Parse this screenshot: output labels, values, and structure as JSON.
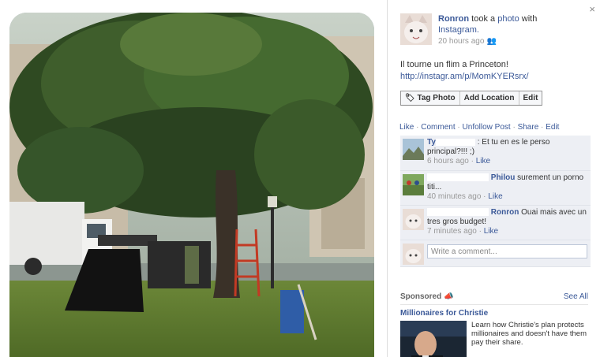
{
  "post": {
    "owner": "Ronron",
    "action_text": "took a",
    "object": "photo",
    "with_text": "with",
    "app": "Instagram.",
    "time": "20 hours ago",
    "message": "Il tourne un flim a Princeton!",
    "link": "http://instagr.am/p/MomKYERsrx/"
  },
  "buttons": {
    "tag": "Tag Photo",
    "location": "Add Location",
    "edit": "Edit"
  },
  "actions": {
    "like": "Like",
    "comment": "Comment",
    "unfollow": "Unfollow Post",
    "share": "Share",
    "edit": "Edit"
  },
  "comments": [
    {
      "name": "Ty",
      "text": ": Et tu en es le perso principal?!!! ;)",
      "time": "6 hours ago",
      "like": "Like"
    },
    {
      "name": "Philou",
      "text": "surement un porno titi...",
      "time": "40 minutes ago",
      "like": "Like"
    },
    {
      "name": "Ronron",
      "text": "Ouai mais avec un tres gros budget!",
      "time": "7 minutes ago",
      "like": "Like"
    }
  ],
  "write_placeholder": "Write a comment...",
  "sponsored": {
    "label": "Sponsored",
    "see_all": "See All",
    "title": "Millionaires for Christie",
    "body": "Learn how Christie's plan protects millionaires and doesn't have them pay their share."
  },
  "close": "×",
  "separator": "·",
  "icons": {
    "close": "close-icon",
    "tag": "tag-icon",
    "audience": "friends-icon",
    "sponsored": "megaphone-icon"
  }
}
